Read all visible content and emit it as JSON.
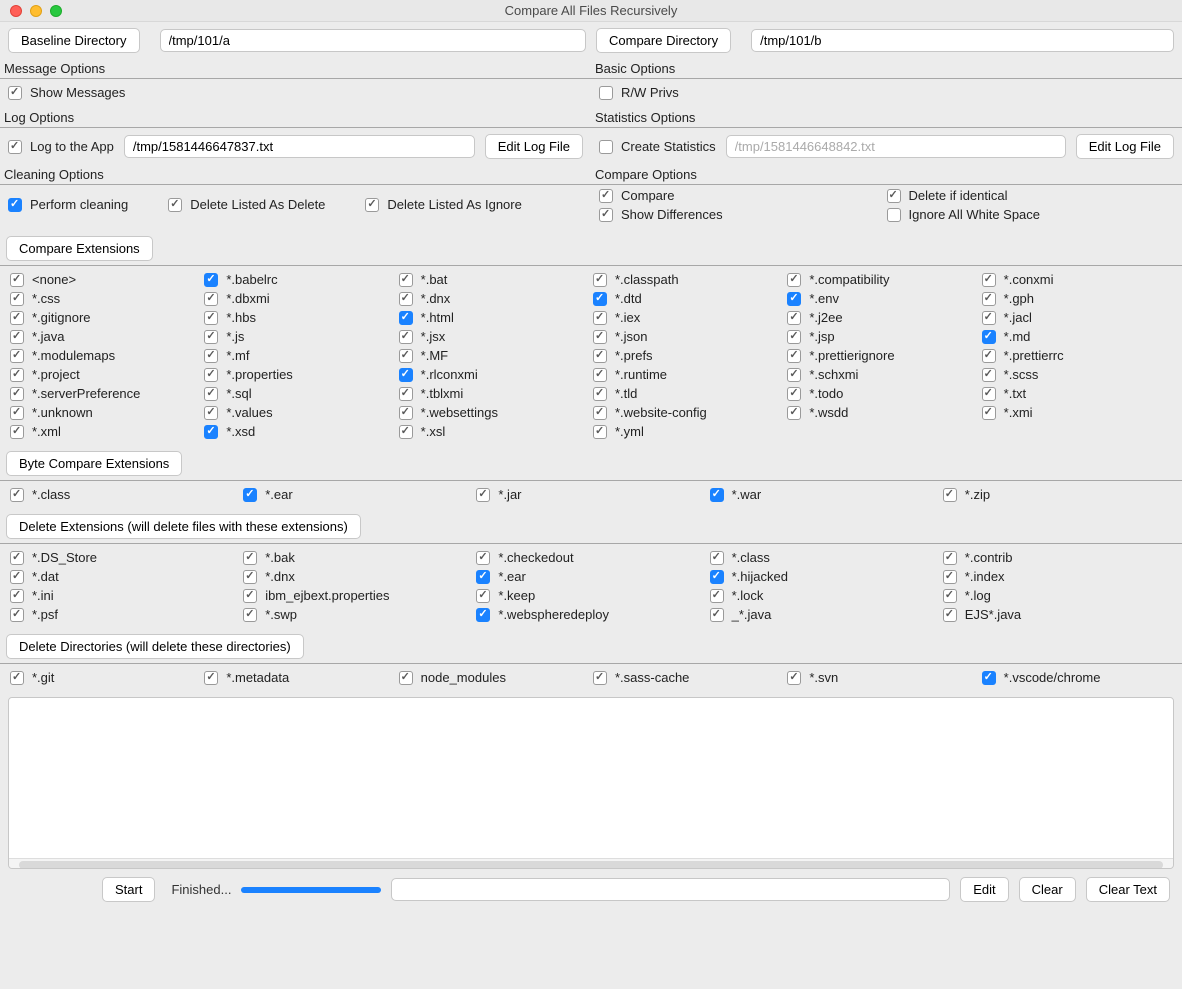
{
  "title": "Compare All Files Recursively",
  "header": {
    "baseline_btn": "Baseline Directory",
    "baseline_value": "/tmp/101/a",
    "compare_btn": "Compare Directory",
    "compare_value": "/tmp/101/b"
  },
  "sections": {
    "message": "Message Options",
    "basic": "Basic Options",
    "log": "Log Options",
    "stats": "Statistics Options",
    "cleaning": "Cleaning Options",
    "compare": "Compare Options"
  },
  "message_opts": {
    "show_messages": "Show Messages"
  },
  "basic_opts": {
    "rw_privs": "R/W Privs"
  },
  "log_opts": {
    "log_to_app": "Log to the App",
    "log_path": "/tmp/1581446647837.txt",
    "edit_btn": "Edit Log File"
  },
  "stats_opts": {
    "create_stats": "Create Statistics",
    "stats_path": "/tmp/1581446648842.txt",
    "edit_btn": "Edit Log File"
  },
  "cleaning": {
    "perform": "Perform cleaning",
    "delete_as_delete": "Delete Listed As Delete",
    "delete_as_ignore": "Delete Listed As Ignore"
  },
  "compare": {
    "compare": "Compare",
    "show_diff": "Show Differences",
    "delete_identical": "Delete if identical",
    "ignore_ws": "Ignore All White Space"
  },
  "compare_ext_btn": "Compare Extensions",
  "compare_ext": [
    {
      "l": "<none>",
      "c": true,
      "h": false
    },
    {
      "l": "*.babelrc",
      "c": true,
      "h": true
    },
    {
      "l": "*.bat",
      "c": true,
      "h": false
    },
    {
      "l": "*.classpath",
      "c": true,
      "h": false
    },
    {
      "l": "*.compatibility",
      "c": true,
      "h": false
    },
    {
      "l": "*.conxmi",
      "c": true,
      "h": false
    },
    {
      "l": "*.css",
      "c": true,
      "h": false
    },
    {
      "l": "*.dbxmi",
      "c": true,
      "h": false
    },
    {
      "l": "*.dnx",
      "c": true,
      "h": false
    },
    {
      "l": "*.dtd",
      "c": true,
      "h": true
    },
    {
      "l": "*.env",
      "c": true,
      "h": true
    },
    {
      "l": "*.gph",
      "c": true,
      "h": false
    },
    {
      "l": "*.gitignore",
      "c": true,
      "h": false
    },
    {
      "l": "*.hbs",
      "c": true,
      "h": false
    },
    {
      "l": "*.html",
      "c": true,
      "h": true
    },
    {
      "l": "*.iex",
      "c": true,
      "h": false
    },
    {
      "l": "*.j2ee",
      "c": true,
      "h": false
    },
    {
      "l": "*.jacl",
      "c": true,
      "h": false
    },
    {
      "l": "*.java",
      "c": true,
      "h": false
    },
    {
      "l": "*.js",
      "c": true,
      "h": false
    },
    {
      "l": "*.jsx",
      "c": true,
      "h": false
    },
    {
      "l": "*.json",
      "c": true,
      "h": false
    },
    {
      "l": "*.jsp",
      "c": true,
      "h": false
    },
    {
      "l": "*.md",
      "c": true,
      "h": true
    },
    {
      "l": "*.modulemaps",
      "c": true,
      "h": false
    },
    {
      "l": "*.mf",
      "c": true,
      "h": false
    },
    {
      "l": "*.MF",
      "c": true,
      "h": false
    },
    {
      "l": "*.prefs",
      "c": true,
      "h": false
    },
    {
      "l": "*.prettierignore",
      "c": true,
      "h": false
    },
    {
      "l": "*.prettierrc",
      "c": true,
      "h": false
    },
    {
      "l": "*.project",
      "c": true,
      "h": false
    },
    {
      "l": "*.properties",
      "c": true,
      "h": false
    },
    {
      "l": "*.rlconxmi",
      "c": true,
      "h": true
    },
    {
      "l": "*.runtime",
      "c": true,
      "h": false
    },
    {
      "l": "*.schxmi",
      "c": true,
      "h": false
    },
    {
      "l": "*.scss",
      "c": true,
      "h": false
    },
    {
      "l": "*.serverPreference",
      "c": true,
      "h": false
    },
    {
      "l": "*.sql",
      "c": true,
      "h": false
    },
    {
      "l": "*.tblxmi",
      "c": true,
      "h": false
    },
    {
      "l": "*.tld",
      "c": true,
      "h": false
    },
    {
      "l": "*.todo",
      "c": true,
      "h": false
    },
    {
      "l": "*.txt",
      "c": true,
      "h": false
    },
    {
      "l": "*.unknown",
      "c": true,
      "h": false
    },
    {
      "l": "*.values",
      "c": true,
      "h": false
    },
    {
      "l": "*.websettings",
      "c": true,
      "h": false
    },
    {
      "l": "*.website-config",
      "c": true,
      "h": false
    },
    {
      "l": "*.wsdd",
      "c": true,
      "h": false
    },
    {
      "l": "*.xmi",
      "c": true,
      "h": false
    },
    {
      "l": "*.xml",
      "c": true,
      "h": false
    },
    {
      "l": "*.xsd",
      "c": true,
      "h": true
    },
    {
      "l": "*.xsl",
      "c": true,
      "h": false
    },
    {
      "l": "*.yml",
      "c": true,
      "h": false
    }
  ],
  "byte_ext_btn": "Byte Compare Extensions",
  "byte_ext": [
    {
      "l": "*.class",
      "c": true,
      "h": false
    },
    {
      "l": "*.ear",
      "c": true,
      "h": true
    },
    {
      "l": "*.jar",
      "c": true,
      "h": false
    },
    {
      "l": "*.war",
      "c": true,
      "h": true
    },
    {
      "l": "*.zip",
      "c": true,
      "h": false
    }
  ],
  "delete_ext_btn": "Delete Extensions (will delete files with these extensions)",
  "delete_ext": [
    {
      "l": "*.DS_Store",
      "c": true,
      "h": false
    },
    {
      "l": "*.bak",
      "c": true,
      "h": false
    },
    {
      "l": "*.checkedout",
      "c": true,
      "h": false
    },
    {
      "l": "*.class",
      "c": true,
      "h": false
    },
    {
      "l": "*.contrib",
      "c": true,
      "h": false
    },
    {
      "l": "*.dat",
      "c": true,
      "h": false
    },
    {
      "l": "*.dnx",
      "c": true,
      "h": false
    },
    {
      "l": "*.ear",
      "c": true,
      "h": true
    },
    {
      "l": "*.hijacked",
      "c": true,
      "h": true
    },
    {
      "l": "*.index",
      "c": true,
      "h": false
    },
    {
      "l": "*.ini",
      "c": true,
      "h": false
    },
    {
      "l": "ibm_ejbext.properties",
      "c": true,
      "h": false
    },
    {
      "l": "*.keep",
      "c": true,
      "h": false
    },
    {
      "l": "*.lock",
      "c": true,
      "h": false
    },
    {
      "l": "*.log",
      "c": true,
      "h": false
    },
    {
      "l": "*.psf",
      "c": true,
      "h": false
    },
    {
      "l": "*.swp",
      "c": true,
      "h": false
    },
    {
      "l": "*.webspheredeploy",
      "c": true,
      "h": true
    },
    {
      "l": "_*.java",
      "c": true,
      "h": false
    },
    {
      "l": "EJS*.java",
      "c": true,
      "h": false
    }
  ],
  "delete_dirs_btn": "Delete Directories (will delete these directories)",
  "delete_dirs": [
    {
      "l": "*.git",
      "c": true,
      "h": false
    },
    {
      "l": "*.metadata",
      "c": true,
      "h": false
    },
    {
      "l": "node_modules",
      "c": true,
      "h": false
    },
    {
      "l": "*.sass-cache",
      "c": true,
      "h": false
    },
    {
      "l": "*.svn",
      "c": true,
      "h": false
    },
    {
      "l": "*.vscode/chrome",
      "c": true,
      "h": true
    }
  ],
  "bottom": {
    "start": "Start",
    "finished": "Finished...",
    "progress_pct": 100,
    "edit": "Edit",
    "clear": "Clear",
    "clear_text": "Clear Text"
  }
}
